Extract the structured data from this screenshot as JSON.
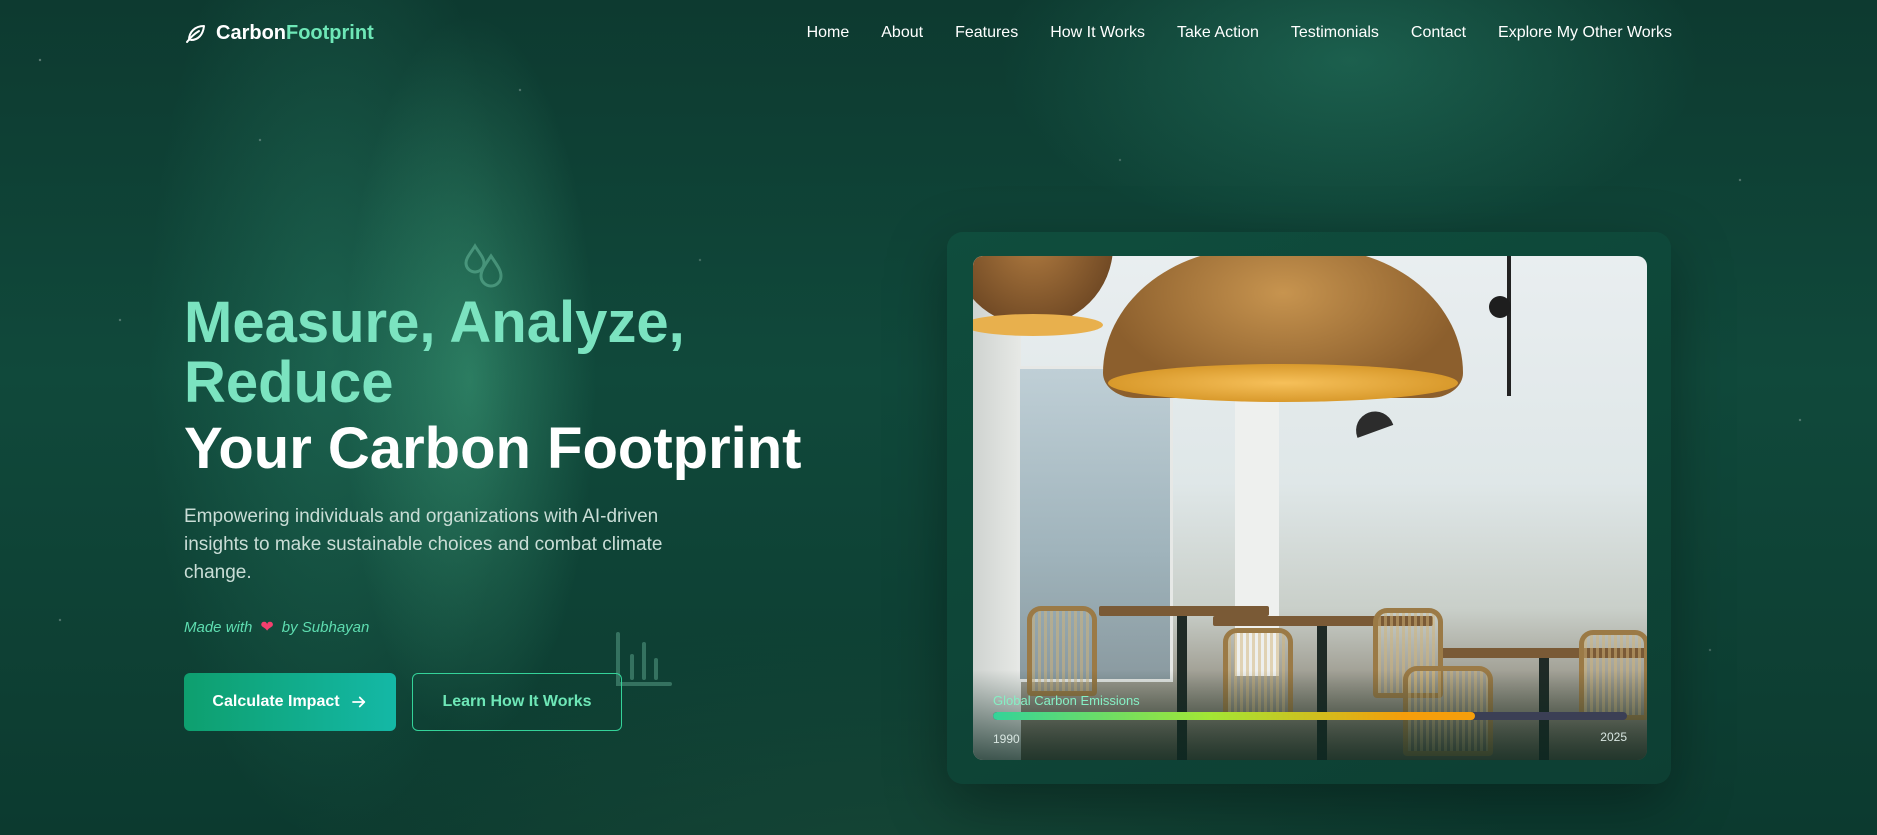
{
  "brand": {
    "part1": "Carbon",
    "part2": "Footprint"
  },
  "nav": {
    "items": [
      "Home",
      "About",
      "Features",
      "How It Works",
      "Take Action",
      "Testimonials",
      "Contact",
      "Explore My Other Works"
    ]
  },
  "hero": {
    "headline_green": "Measure, Analyze, Reduce",
    "headline_white": "Your Carbon Footprint",
    "description": "Empowering individuals and organizations with AI-driven insights to make sustainable choices and combat climate change.",
    "made_prefix": "Made with",
    "made_suffix": "by Subhayan",
    "primary_button": "Calculate Impact",
    "secondary_button": "Learn How It Works"
  },
  "emissions": {
    "label": "Global Carbon Emissions",
    "start_year": "1990",
    "end_year": "2025",
    "progress": 0.76
  },
  "icons": {
    "brand": "leaf-icon",
    "primary_button": "arrow-right-icon",
    "made_with": "heart-icon",
    "decor_1": "water-drops-icon",
    "decor_2": "bar-chart-icon"
  },
  "colors": {
    "accent": "#6ee7b7",
    "button_gradient_start": "#0e9f6e",
    "button_gradient_end": "#14b8a6",
    "heart": "#f43f6e",
    "progress_end": "#f59e0b"
  }
}
